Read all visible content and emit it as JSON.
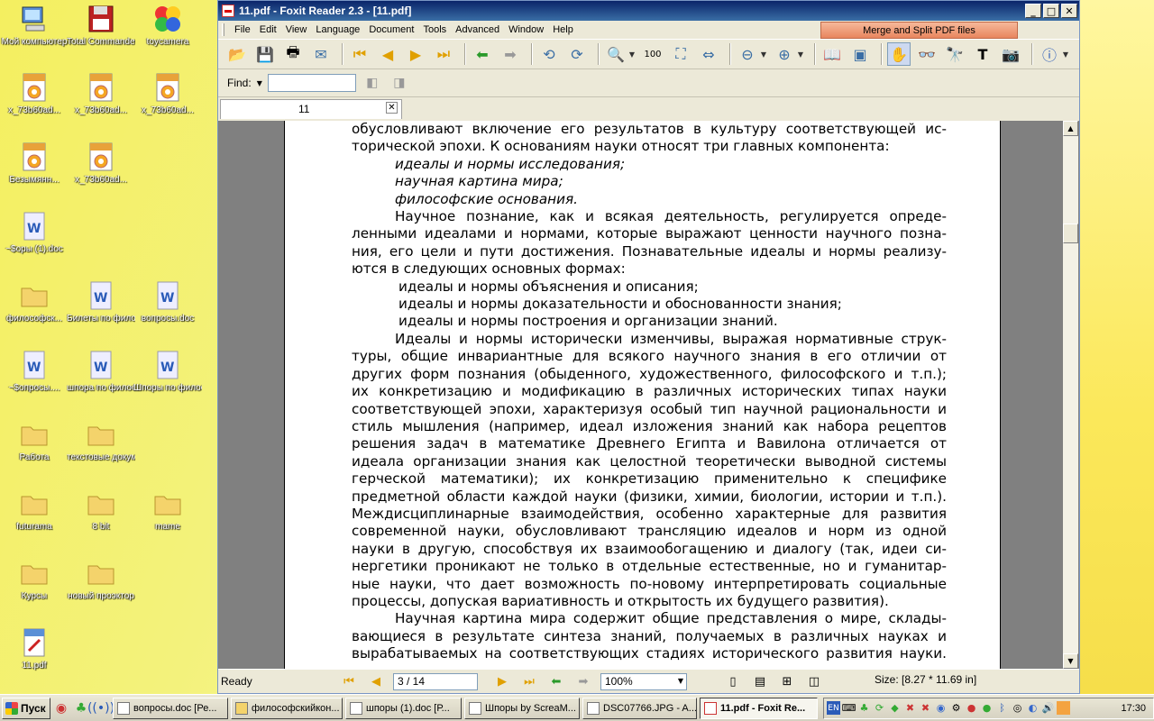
{
  "desktop": {
    "icons": [
      {
        "label": "Мой компьютер"
      },
      {
        "label": "Total Commander"
      },
      {
        "label": "toycamera"
      },
      {
        "label": "x_73b60ad..."
      },
      {
        "label": "x_73b60ad..."
      },
      {
        "label": "x_73b60ad..."
      },
      {
        "label": "Безымянн..."
      },
      {
        "label": "x_73b60ad..."
      },
      {
        "label": "~$оры (1).doc"
      },
      {
        "label": "философск..."
      },
      {
        "label": "Билеты по философи..."
      },
      {
        "label": "вопросы.doc"
      },
      {
        "label": "~$опросы...."
      },
      {
        "label": "шпора по философи..."
      },
      {
        "label": "Шпоры по философи..."
      },
      {
        "label": "Работа"
      },
      {
        "label": "текстовые документы"
      },
      {
        "label": "futurama"
      },
      {
        "label": "8 bit"
      },
      {
        "label": "mame"
      },
      {
        "label": "Курсы"
      },
      {
        "label": "новый проэктор"
      },
      {
        "label": "11.pdf"
      }
    ]
  },
  "window": {
    "title": "11.pdf - Foxit Reader 2.3 - [11.pdf]",
    "menu": [
      "File",
      "Edit",
      "View",
      "Language",
      "Document",
      "Tools",
      "Advanced",
      "Window",
      "Help"
    ],
    "merge_label": "Merge and Split PDF files",
    "find_label": "Find:",
    "find_value": "",
    "tab_label": "11",
    "status_ready": "Ready",
    "page_field": "3 / 14",
    "zoom_field": "100%",
    "size_field": "Size: [8.27 * 11.69 in]"
  },
  "document": {
    "lines": [
      {
        "t": "обусловливают включение его результатов в культуру соответствующей ис-",
        "c": "p"
      },
      {
        "t": "торической эпохи. К основаниям науки относят три главных компонента:",
        "c": "p last"
      },
      {
        "t": "идеалы и нормы исследования;",
        "c": "li"
      },
      {
        "t": "научная картина мира;",
        "c": "li"
      },
      {
        "t": "философские основания.",
        "c": "li"
      },
      {
        "t": "Научное познание, как и всякая деятельность, регулируется опреде-",
        "c": "p ind"
      },
      {
        "t": "ленными идеалами и нормами, которые выражают ценности научного позна-",
        "c": "p"
      },
      {
        "t": "ния, его цели и пути достижения. Познавательные идеалы и нормы реализу-",
        "c": "p"
      },
      {
        "t": "ются в следующих основных формах:",
        "c": "p last"
      },
      {
        "t": "идеалы и нормы объяснения и описания;",
        "c": "li2"
      },
      {
        "t": "идеалы и нормы доказательности и обоснованности знания;",
        "c": "li2"
      },
      {
        "t": "идеалы и нормы построения и организации знаний.",
        "c": "li2"
      },
      {
        "t": "Идеалы и нормы исторически изменчивы, выражая нормативные струк-",
        "c": "p ind"
      },
      {
        "t": "туры, общие инвариантные для всякого научного знания в его отличии от",
        "c": "p"
      },
      {
        "t": "других форм познания (обыденного, художественного, философского и т.п.);",
        "c": "p"
      },
      {
        "t": "их конкретизацию и модификацию в различных исторических типах науки",
        "c": "p"
      },
      {
        "t": "соответствующей эпохи, характеризуя особый тип научной рациональности и",
        "c": "p"
      },
      {
        "t": "стиль мышления (например, идеал изложения знаний как набора рецептов",
        "c": "p"
      },
      {
        "t": "решения задач в математике Древнего Египта и Вавилона отличается от",
        "c": "p"
      },
      {
        "t": "идеала организации знания как целостной теоретически выводной системы",
        "c": "p"
      },
      {
        "t": "герческой математики); их конкретизацию применительно к специфике",
        "c": "p"
      },
      {
        "t": "предметной области каждой науки (физики, химии, биологии, истории и т.п.).",
        "c": "p"
      },
      {
        "t": "Междисциплинарные взаимодействия, особенно характерные для развития",
        "c": "p"
      },
      {
        "t": "современной науки, обусловливают трансляцию идеалов и норм из одной",
        "c": "p"
      },
      {
        "t": "науки в другую, способствуя их взаимообогащению и диалогу (так, идеи си-",
        "c": "p"
      },
      {
        "t": "нергетики проникают не только в отдельные естественные, но и гуманитар-",
        "c": "p"
      },
      {
        "t": "ные науки, что дает возможность по-новому интерпретировать социальные",
        "c": "p"
      },
      {
        "t": "процессы, допуская вариативность и открытость их будущего развития).",
        "c": "p last"
      },
      {
        "t": "Научная картина мира содержит общие представления о мире, склады-",
        "c": "p ind"
      },
      {
        "t": "вающиеся в результате синтеза знаний, получаемых в различных науках и",
        "c": "p"
      },
      {
        "t": "вырабатываемых на соответствующих стадиях исторического развития науки.",
        "c": "p"
      }
    ]
  },
  "taskbar": {
    "start_label": "Пуск",
    "tasks": [
      {
        "label": "вопросы.doc [Ре..."
      },
      {
        "label": "философскийкон..."
      },
      {
        "label": "шпоры (1).doc [Р..."
      },
      {
        "label": "Шпоры by ScreaM..."
      },
      {
        "label": "DSC07766.JPG - A..."
      },
      {
        "label": "11.pdf - Foxit Re..."
      }
    ],
    "lang": "EN",
    "clock": "17:30"
  },
  "colors": {
    "titlebar": "#0a246a",
    "chrome": "#ece9d8",
    "viewer_bg": "#808080",
    "merge_button": "#e8855e"
  }
}
